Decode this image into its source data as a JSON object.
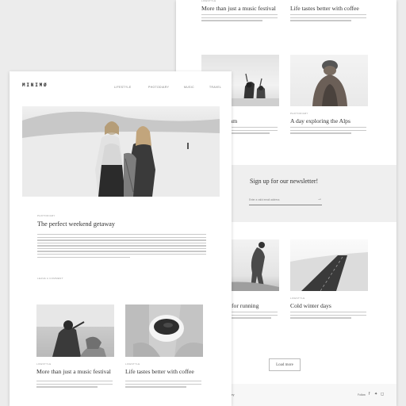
{
  "brand": {
    "logo": "MINIMØ"
  },
  "nav": {
    "items": [
      "Lifestyle",
      "Photodiary",
      "Music",
      "Travel"
    ]
  },
  "hero_post": {
    "category": "Photodiary",
    "title": "The perfect weekend getaway",
    "read_more": "Leave a comment"
  },
  "back_page": {
    "top_posts": [
      {
        "title": "More than just a music festival"
      },
      {
        "title": "Life tastes better with coffee"
      }
    ],
    "mid_posts": [
      {
        "title": "ream",
        "category": ""
      },
      {
        "title": "A day exploring the Alps",
        "category": "Photodiary"
      }
    ],
    "newsletter": {
      "title": "Sign up for our newsletter!",
      "placeholder": "Enter a valid email address"
    },
    "bottom_posts": [
      {
        "title": "for running",
        "category": ""
      },
      {
        "title": "Cold winter days",
        "category": "Lifestyle"
      }
    ],
    "load_more": "Load more",
    "footer": {
      "left": "ney",
      "follow": "Follow"
    }
  },
  "front_posts": [
    {
      "category": "Lifestyle",
      "title": "More than just a music festival"
    },
    {
      "category": "Lifestyle",
      "title": "Life tastes better with coffee"
    }
  ]
}
